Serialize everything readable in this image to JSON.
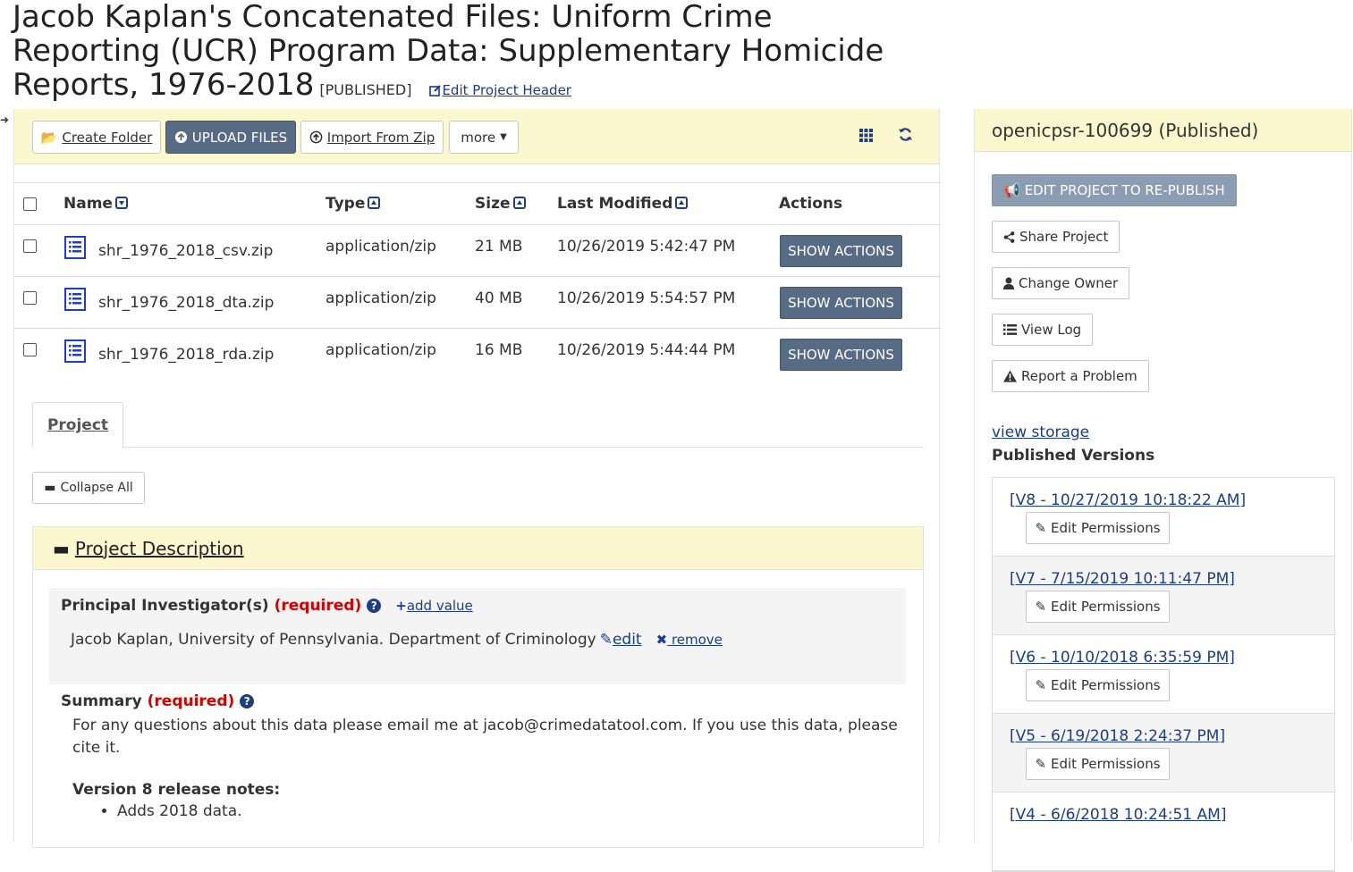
{
  "header": {
    "title": "Jacob Kaplan's Concatenated Files: Uniform Crime Reporting (UCR) Program Data: Supplementary Homicide Reports, 1976-2018",
    "status": "[PUBLISHED]",
    "edit_header_label": "Edit Project Header"
  },
  "toolbar": {
    "create_folder": "Create Folder",
    "upload_files": "UPLOAD FILES",
    "import_zip": "Import From Zip",
    "more": "more"
  },
  "table": {
    "headers": {
      "name": "Name",
      "type": "Type",
      "size": "Size",
      "modified": "Last Modified",
      "actions": "Actions"
    },
    "rows": [
      {
        "name": "shr_1976_2018_csv.zip",
        "type": "application/zip",
        "size": "21 MB",
        "modified": "10/26/2019 5:42:47 PM",
        "action": "SHOW ACTIONS"
      },
      {
        "name": "shr_1976_2018_dta.zip",
        "type": "application/zip",
        "size": "40 MB",
        "modified": "10/26/2019 5:54:57 PM",
        "action": "SHOW ACTIONS"
      },
      {
        "name": "shr_1976_2018_rda.zip",
        "type": "application/zip",
        "size": "16 MB",
        "modified": "10/26/2019 5:44:44 PM",
        "action": "SHOW ACTIONS"
      }
    ]
  },
  "tabs": {
    "project": "Project"
  },
  "collapse_all": "Collapse All",
  "description": {
    "heading": "Project Description",
    "pi_label": "Principal Investigator(s)",
    "required": "(required)",
    "add_value": "add value",
    "pi_value": "Jacob Kaplan, University of Pennsylvania. Department of Criminology",
    "edit": "edit",
    "remove": "remove",
    "summary_label": "Summary",
    "summary_text": "For any questions about this data please email me at jacob@crimedatatool.com. If you use this data, please cite it.",
    "notes_title": "Version 8 release notes:",
    "notes": [
      "Adds 2018 data."
    ]
  },
  "sidebar": {
    "project_id": "openicpsr-100699 (Published)",
    "edit_republish": "EDIT PROJECT TO RE-PUBLISH",
    "share": "Share Project",
    "change_owner": "Change Owner",
    "view_log": "View Log",
    "report": "Report a Problem",
    "view_storage": "view storage",
    "published_versions": "Published Versions",
    "edit_permissions": "Edit Permissions",
    "versions": [
      "[V8 - 10/27/2019 10:18:22 AM]",
      "[V7 - 7/15/2019 10:11:47 PM]",
      "[V6 - 10/10/2018 6:35:59 PM]",
      "[V5 - 6/19/2018 2:24:37 PM]",
      "[V4 - 6/6/2018 10:24:51 AM]"
    ]
  },
  "colors": {
    "accent": "#1f3d80",
    "button_primary": "#586b85",
    "highlight": "#fbf8cf",
    "required": "#d60000"
  }
}
